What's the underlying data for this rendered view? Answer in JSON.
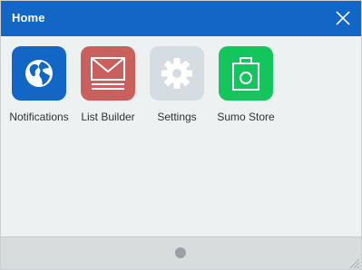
{
  "window": {
    "title": "Home",
    "close_icon": "close-icon"
  },
  "apps": [
    {
      "label": "Notifications",
      "icon": "globe-icon",
      "color": "#1266c6"
    },
    {
      "label": "List Builder",
      "icon": "envelope-icon",
      "color": "#c8605e"
    },
    {
      "label": "Settings",
      "icon": "gear-icon",
      "color": "#d5dde3"
    },
    {
      "label": "Sumo Store",
      "icon": "shopping-bag-icon",
      "color": "#14c45d"
    }
  ],
  "footer": {
    "page_indicator": "page-dot",
    "resize_icon": "resize-grip-icon"
  },
  "colors": {
    "titlebar": "#1266c6",
    "background": "#edf1f2",
    "footer": "#d9dcdc"
  }
}
